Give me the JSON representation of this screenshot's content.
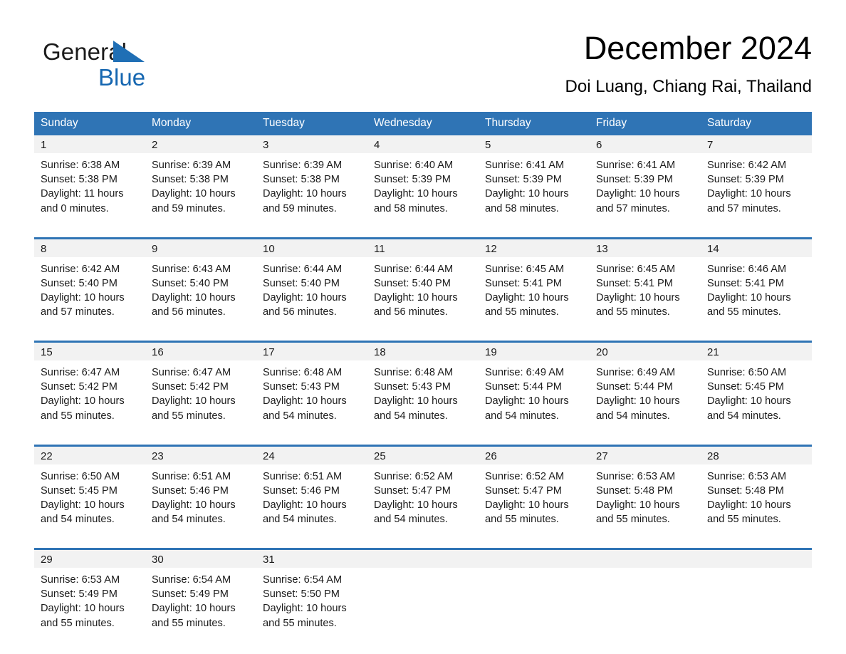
{
  "brand": {
    "name_part1": "General",
    "name_part2": "Blue",
    "triangle_color": "#1f6fb5",
    "text_color_part2": "#1667b1"
  },
  "header": {
    "title": "December 2024",
    "location": "Doi Luang, Chiang Rai, Thailand"
  },
  "theme": {
    "header_bg": "#2f74b5",
    "header_text": "#ffffff",
    "daynum_band_bg": "#f2f2f2",
    "row_divider": "#2f74b5",
    "body_text": "#1b1b1b",
    "page_bg": "#ffffff"
  },
  "calendar": {
    "weekday_headers": [
      "Sunday",
      "Monday",
      "Tuesday",
      "Wednesday",
      "Thursday",
      "Friday",
      "Saturday"
    ],
    "weeks": [
      [
        {
          "day": "1",
          "sunrise": "Sunrise: 6:38 AM",
          "sunset": "Sunset: 5:38 PM",
          "daylight_line1": "Daylight: 11 hours",
          "daylight_line2": "and 0 minutes."
        },
        {
          "day": "2",
          "sunrise": "Sunrise: 6:39 AM",
          "sunset": "Sunset: 5:38 PM",
          "daylight_line1": "Daylight: 10 hours",
          "daylight_line2": "and 59 minutes."
        },
        {
          "day": "3",
          "sunrise": "Sunrise: 6:39 AM",
          "sunset": "Sunset: 5:38 PM",
          "daylight_line1": "Daylight: 10 hours",
          "daylight_line2": "and 59 minutes."
        },
        {
          "day": "4",
          "sunrise": "Sunrise: 6:40 AM",
          "sunset": "Sunset: 5:39 PM",
          "daylight_line1": "Daylight: 10 hours",
          "daylight_line2": "and 58 minutes."
        },
        {
          "day": "5",
          "sunrise": "Sunrise: 6:41 AM",
          "sunset": "Sunset: 5:39 PM",
          "daylight_line1": "Daylight: 10 hours",
          "daylight_line2": "and 58 minutes."
        },
        {
          "day": "6",
          "sunrise": "Sunrise: 6:41 AM",
          "sunset": "Sunset: 5:39 PM",
          "daylight_line1": "Daylight: 10 hours",
          "daylight_line2": "and 57 minutes."
        },
        {
          "day": "7",
          "sunrise": "Sunrise: 6:42 AM",
          "sunset": "Sunset: 5:39 PM",
          "daylight_line1": "Daylight: 10 hours",
          "daylight_line2": "and 57 minutes."
        }
      ],
      [
        {
          "day": "8",
          "sunrise": "Sunrise: 6:42 AM",
          "sunset": "Sunset: 5:40 PM",
          "daylight_line1": "Daylight: 10 hours",
          "daylight_line2": "and 57 minutes."
        },
        {
          "day": "9",
          "sunrise": "Sunrise: 6:43 AM",
          "sunset": "Sunset: 5:40 PM",
          "daylight_line1": "Daylight: 10 hours",
          "daylight_line2": "and 56 minutes."
        },
        {
          "day": "10",
          "sunrise": "Sunrise: 6:44 AM",
          "sunset": "Sunset: 5:40 PM",
          "daylight_line1": "Daylight: 10 hours",
          "daylight_line2": "and 56 minutes."
        },
        {
          "day": "11",
          "sunrise": "Sunrise: 6:44 AM",
          "sunset": "Sunset: 5:40 PM",
          "daylight_line1": "Daylight: 10 hours",
          "daylight_line2": "and 56 minutes."
        },
        {
          "day": "12",
          "sunrise": "Sunrise: 6:45 AM",
          "sunset": "Sunset: 5:41 PM",
          "daylight_line1": "Daylight: 10 hours",
          "daylight_line2": "and 55 minutes."
        },
        {
          "day": "13",
          "sunrise": "Sunrise: 6:45 AM",
          "sunset": "Sunset: 5:41 PM",
          "daylight_line1": "Daylight: 10 hours",
          "daylight_line2": "and 55 minutes."
        },
        {
          "day": "14",
          "sunrise": "Sunrise: 6:46 AM",
          "sunset": "Sunset: 5:41 PM",
          "daylight_line1": "Daylight: 10 hours",
          "daylight_line2": "and 55 minutes."
        }
      ],
      [
        {
          "day": "15",
          "sunrise": "Sunrise: 6:47 AM",
          "sunset": "Sunset: 5:42 PM",
          "daylight_line1": "Daylight: 10 hours",
          "daylight_line2": "and 55 minutes."
        },
        {
          "day": "16",
          "sunrise": "Sunrise: 6:47 AM",
          "sunset": "Sunset: 5:42 PM",
          "daylight_line1": "Daylight: 10 hours",
          "daylight_line2": "and 55 minutes."
        },
        {
          "day": "17",
          "sunrise": "Sunrise: 6:48 AM",
          "sunset": "Sunset: 5:43 PM",
          "daylight_line1": "Daylight: 10 hours",
          "daylight_line2": "and 54 minutes."
        },
        {
          "day": "18",
          "sunrise": "Sunrise: 6:48 AM",
          "sunset": "Sunset: 5:43 PM",
          "daylight_line1": "Daylight: 10 hours",
          "daylight_line2": "and 54 minutes."
        },
        {
          "day": "19",
          "sunrise": "Sunrise: 6:49 AM",
          "sunset": "Sunset: 5:44 PM",
          "daylight_line1": "Daylight: 10 hours",
          "daylight_line2": "and 54 minutes."
        },
        {
          "day": "20",
          "sunrise": "Sunrise: 6:49 AM",
          "sunset": "Sunset: 5:44 PM",
          "daylight_line1": "Daylight: 10 hours",
          "daylight_line2": "and 54 minutes."
        },
        {
          "day": "21",
          "sunrise": "Sunrise: 6:50 AM",
          "sunset": "Sunset: 5:45 PM",
          "daylight_line1": "Daylight: 10 hours",
          "daylight_line2": "and 54 minutes."
        }
      ],
      [
        {
          "day": "22",
          "sunrise": "Sunrise: 6:50 AM",
          "sunset": "Sunset: 5:45 PM",
          "daylight_line1": "Daylight: 10 hours",
          "daylight_line2": "and 54 minutes."
        },
        {
          "day": "23",
          "sunrise": "Sunrise: 6:51 AM",
          "sunset": "Sunset: 5:46 PM",
          "daylight_line1": "Daylight: 10 hours",
          "daylight_line2": "and 54 minutes."
        },
        {
          "day": "24",
          "sunrise": "Sunrise: 6:51 AM",
          "sunset": "Sunset: 5:46 PM",
          "daylight_line1": "Daylight: 10 hours",
          "daylight_line2": "and 54 minutes."
        },
        {
          "day": "25",
          "sunrise": "Sunrise: 6:52 AM",
          "sunset": "Sunset: 5:47 PM",
          "daylight_line1": "Daylight: 10 hours",
          "daylight_line2": "and 54 minutes."
        },
        {
          "day": "26",
          "sunrise": "Sunrise: 6:52 AM",
          "sunset": "Sunset: 5:47 PM",
          "daylight_line1": "Daylight: 10 hours",
          "daylight_line2": "and 55 minutes."
        },
        {
          "day": "27",
          "sunrise": "Sunrise: 6:53 AM",
          "sunset": "Sunset: 5:48 PM",
          "daylight_line1": "Daylight: 10 hours",
          "daylight_line2": "and 55 minutes."
        },
        {
          "day": "28",
          "sunrise": "Sunrise: 6:53 AM",
          "sunset": "Sunset: 5:48 PM",
          "daylight_line1": "Daylight: 10 hours",
          "daylight_line2": "and 55 minutes."
        }
      ],
      [
        {
          "day": "29",
          "sunrise": "Sunrise: 6:53 AM",
          "sunset": "Sunset: 5:49 PM",
          "daylight_line1": "Daylight: 10 hours",
          "daylight_line2": "and 55 minutes."
        },
        {
          "day": "30",
          "sunrise": "Sunrise: 6:54 AM",
          "sunset": "Sunset: 5:49 PM",
          "daylight_line1": "Daylight: 10 hours",
          "daylight_line2": "and 55 minutes."
        },
        {
          "day": "31",
          "sunrise": "Sunrise: 6:54 AM",
          "sunset": "Sunset: 5:50 PM",
          "daylight_line1": "Daylight: 10 hours",
          "daylight_line2": "and 55 minutes."
        },
        {
          "day": "",
          "sunrise": "",
          "sunset": "",
          "daylight_line1": "",
          "daylight_line2": ""
        },
        {
          "day": "",
          "sunrise": "",
          "sunset": "",
          "daylight_line1": "",
          "daylight_line2": ""
        },
        {
          "day": "",
          "sunrise": "",
          "sunset": "",
          "daylight_line1": "",
          "daylight_line2": ""
        },
        {
          "day": "",
          "sunrise": "",
          "sunset": "",
          "daylight_line1": "",
          "daylight_line2": ""
        }
      ]
    ]
  }
}
